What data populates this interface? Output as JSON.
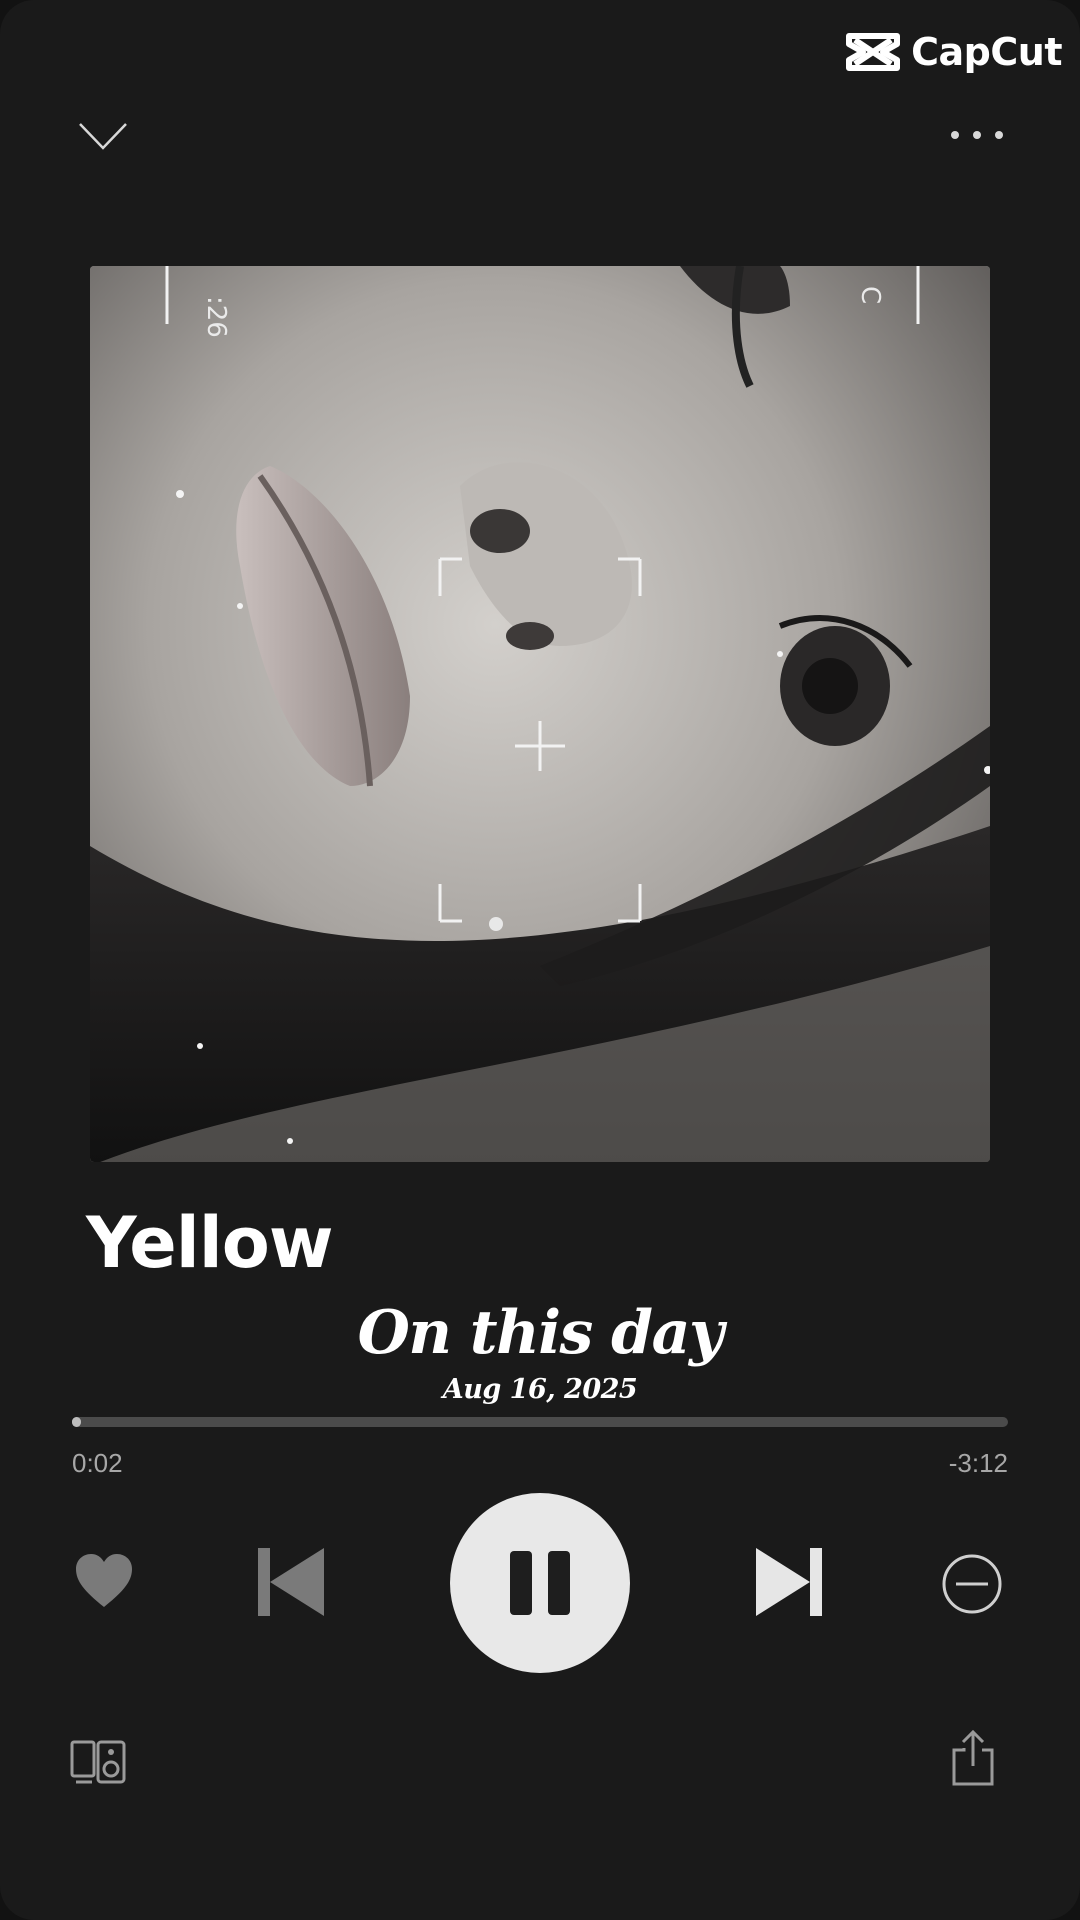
{
  "watermark": {
    "brand": "CapCut"
  },
  "header": {
    "collapse_icon": "chevron-down-icon",
    "more_icon": "more-horizontal-icon"
  },
  "artwork": {
    "description_icon": "album-artwork",
    "overlay_text_left": ":26",
    "overlay_text_right": "C"
  },
  "track": {
    "title": "Yellow",
    "subtitle": "On this day",
    "date": "Aug 16, 2025"
  },
  "progress": {
    "elapsed": "0:02",
    "remaining": "-3:12",
    "fraction": 0.01
  },
  "controls": {
    "like_icon": "heart-icon",
    "previous_icon": "skip-previous-icon",
    "play_state": "playing",
    "pause_icon": "pause-icon",
    "next_icon": "skip-next-icon",
    "remove_icon": "minus-circle-icon"
  },
  "footer": {
    "devices_icon": "connect-devices-icon",
    "share_icon": "share-icon"
  },
  "colors": {
    "background": "#1a1a1a",
    "text": "#ffffff",
    "muted": "#a7a7a7",
    "track_bg": "#4b4b4b",
    "track_fill": "#bdbdbd",
    "play_button": "#e8e8e8"
  }
}
